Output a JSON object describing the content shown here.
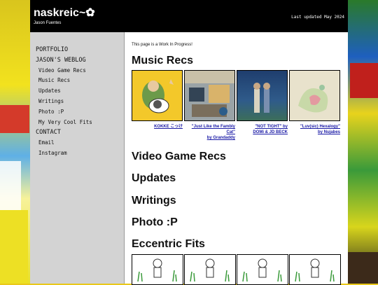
{
  "header": {
    "title": "naskreic~✿",
    "subtitle": "Jason Fuentes",
    "updated": "Last updated May 2024"
  },
  "nav": {
    "portfolio": "PORTFOLIO",
    "weblog": "JASON'S WEBLOG",
    "weblog_items": [
      "Video Game Recs",
      "Music Recs",
      "Updates",
      "Writings",
      "Photo :P",
      "My Very Cool Fits"
    ],
    "contact": "CONTACT",
    "contact_items": [
      "Email",
      "Instagram"
    ]
  },
  "main": {
    "wip": "This page is a Work In Progress!",
    "music_heading": "Music Recs",
    "albums": [
      {
        "line1": "KOKKE こっけ",
        "line2": "",
        "line3": ""
      },
      {
        "line1": "\"Just Like the Fambly",
        "line2": "Cat\"",
        "line3": "by Grandaddy"
      },
      {
        "line1": "\"NOT TIGHT\" by",
        "line2": "DOMi & JD BECK",
        "line3": ""
      },
      {
        "line1": "\"Luv(sic) Hexalogy\"",
        "line2": "by Nujabes",
        "line3": ""
      }
    ],
    "sections": [
      "Video Game Recs",
      "Updates",
      "Writings",
      "Photo :P",
      "Eccentric Fits"
    ]
  }
}
